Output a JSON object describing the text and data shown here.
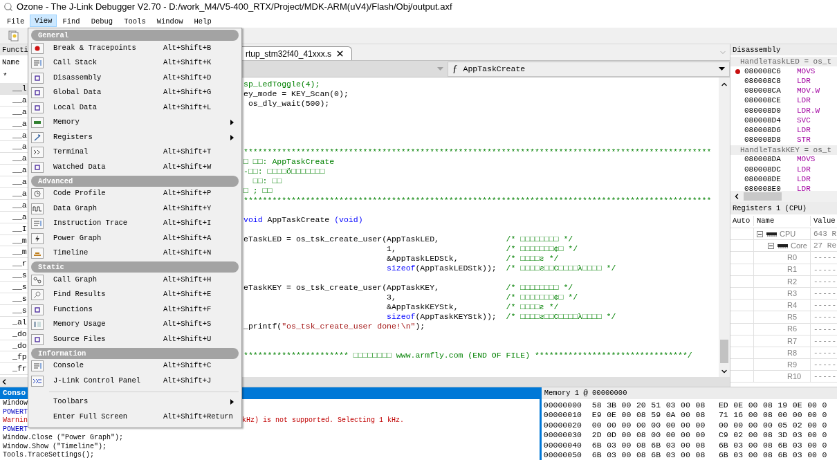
{
  "window": {
    "title": "Ozone - The J-Link Debugger V2.70 - D:/work_M4/V5-400_RTX/Project/MDK-ARM(uV4)/Flash/Obj/output.axf"
  },
  "menu_bar": [
    {
      "label": "File",
      "selected": false
    },
    {
      "label": "View",
      "selected": true
    },
    {
      "label": "Find",
      "selected": false
    },
    {
      "label": "Debug",
      "selected": false
    },
    {
      "label": "Tools",
      "selected": false
    },
    {
      "label": "Window",
      "selected": false
    },
    {
      "label": "Help",
      "selected": false
    }
  ],
  "functions_panel": {
    "title": "Functi",
    "column": "Name",
    "filter": "*",
    "rows": [
      {
        "name": "__l",
        "selected": true
      },
      {
        "name": "__a",
        "selected": false
      },
      {
        "name": "__a",
        "selected": false
      },
      {
        "name": "__a",
        "selected": false
      },
      {
        "name": "__a",
        "selected": false
      },
      {
        "name": "__a",
        "selected": false
      },
      {
        "name": "__a",
        "selected": false
      },
      {
        "name": "__a",
        "selected": false
      },
      {
        "name": "__a",
        "selected": false
      },
      {
        "name": "__a",
        "selected": false
      },
      {
        "name": "__a",
        "selected": false
      },
      {
        "name": "__a",
        "selected": false
      },
      {
        "name": "__I",
        "selected": false
      },
      {
        "name": "__m",
        "selected": false
      },
      {
        "name": "__m",
        "selected": false
      },
      {
        "name": "__r",
        "selected": false
      },
      {
        "name": "__s",
        "selected": false
      },
      {
        "name": "__s",
        "selected": false
      },
      {
        "name": "__s",
        "selected": false
      },
      {
        "name": "__s",
        "selected": false
      },
      {
        "name": "_al",
        "selected": false
      },
      {
        "name": "_do",
        "selected": false
      },
      {
        "name": "_do",
        "selected": false
      },
      {
        "name": "_fp",
        "selected": false
      },
      {
        "name": "_fr",
        "selected": false
      }
    ]
  },
  "editor": {
    "tab": "rtup_stm32f40_41xxx.s",
    "function_symbol": "ƒ",
    "function": "AppTaskCreate",
    "lines": [
      {
        "segments": [
          {
            "kind": "comment",
            "text": "sp_LedToggle(4);"
          }
        ]
      },
      {
        "segments": [
          {
            "kind": "plain",
            "text": "ey_mode = KEY_Scan(0);"
          }
        ]
      },
      {
        "segments": [
          {
            "kind": "plain",
            "text": " os_dly_wait(500);"
          }
        ]
      },
      {
        "blank": true
      },
      {
        "blank": true
      },
      {
        "blank": true
      },
      {
        "blank": true
      },
      {
        "segments": [
          {
            "kind": "comment",
            "text": "**************************************************************************************************"
          }
        ]
      },
      {
        "segments": [
          {
            "kind": "comment",
            "text": "□ □□: AppTaskCreate"
          }
        ]
      },
      {
        "segments": [
          {
            "kind": "comment",
            "text": "-□□: □□□□ö□□□□□□□"
          }
        ]
      },
      {
        "segments": [
          {
            "kind": "comment",
            "text": "  □□: □□"
          }
        ]
      },
      {
        "segments": [
          {
            "kind": "comment",
            "text": "□ ; □□"
          }
        ]
      },
      {
        "segments": [
          {
            "kind": "comment",
            "text": "**************************************************************************************************"
          }
        ]
      },
      {
        "blank": true
      },
      {
        "segments": [
          {
            "kind": "keyword",
            "text": "void"
          },
          {
            "kind": "plain",
            "text": " AppTaskCreate "
          },
          {
            "kind": "keyword",
            "text": "(void)"
          }
        ]
      },
      {
        "blank": true
      },
      {
        "segments": [
          {
            "kind": "plain",
            "text": "eTaskLED = os_tsk_create_user(AppTaskLED,              "
          },
          {
            "kind": "comment",
            "text": "/* □□□□□□□□ */"
          }
        ]
      },
      {
        "segments": [
          {
            "kind": "plain",
            "text": "                              1,                       "
          },
          {
            "kind": "comment",
            "text": "/* □□□□□□□¢□ */"
          }
        ]
      },
      {
        "segments": [
          {
            "kind": "plain",
            "text": "                              &AppTaskLEDStk,          "
          },
          {
            "kind": "comment",
            "text": "/* □□□□ƨ */"
          }
        ]
      },
      {
        "segments": [
          {
            "kind": "keyword",
            "text": "                              sizeof"
          },
          {
            "kind": "plain",
            "text": "(AppTaskLEDStk));  "
          },
          {
            "kind": "comment",
            "text": "/* □□□□ƨ□□C□□□□λ□□□□ */"
          }
        ]
      },
      {
        "blank": true
      },
      {
        "segments": [
          {
            "kind": "plain",
            "text": "eTaskKEY = os_tsk_create_user(AppTaskKEY,              "
          },
          {
            "kind": "comment",
            "text": "/* □□□□□□□□ */"
          }
        ]
      },
      {
        "segments": [
          {
            "kind": "plain",
            "text": "                              3,                       "
          },
          {
            "kind": "comment",
            "text": "/* □□□□□□□¢□ */"
          }
        ]
      },
      {
        "segments": [
          {
            "kind": "plain",
            "text": "                              &AppTaskKEYStk,          "
          },
          {
            "kind": "comment",
            "text": "/* □□□□ƨ */"
          }
        ]
      },
      {
        "segments": [
          {
            "kind": "keyword",
            "text": "                              sizeof"
          },
          {
            "kind": "plain",
            "text": "(AppTaskKEYStk));  "
          },
          {
            "kind": "comment",
            "text": "/* □□□□ƨ□□C□□□□λ□□□□ */"
          }
        ]
      },
      {
        "segments": [
          {
            "kind": "plain",
            "text": "_printf("
          },
          {
            "kind": "string",
            "text": "\"os_tsk_create_user done!\\n\""
          },
          {
            "kind": "plain",
            "text": ");"
          }
        ]
      },
      {
        "blank": true
      },
      {
        "blank": true
      },
      {
        "segments": [
          {
            "kind": "comment",
            "text": "********************** □□□□□□□□ www.armfly.com (END OF FILE) ********************************/"
          }
        ]
      }
    ]
  },
  "view_menu": {
    "sections": [
      {
        "header": "General",
        "items": [
          {
            "label": "Break & Tracepoints",
            "shortcut": "Alt+Shift+B",
            "submenu": false
          },
          {
            "label": "Call Stack",
            "shortcut": "Alt+Shift+K",
            "submenu": false
          },
          {
            "label": "Disassembly",
            "shortcut": "Alt+Shift+D",
            "submenu": false
          },
          {
            "label": "Global Data",
            "shortcut": "Alt+Shift+G",
            "submenu": false
          },
          {
            "label": "Local Data",
            "shortcut": "Alt+Shift+L",
            "submenu": false
          },
          {
            "label": "Memory",
            "submenu": true
          },
          {
            "label": "Registers",
            "submenu": true
          },
          {
            "label": "Terminal",
            "shortcut": "Alt+Shift+T",
            "submenu": false
          },
          {
            "label": "Watched Data",
            "shortcut": "Alt+Shift+W",
            "submenu": false
          }
        ]
      },
      {
        "header": "Advanced",
        "items": [
          {
            "label": "Code Profile",
            "shortcut": "Alt+Shift+P",
            "submenu": false
          },
          {
            "label": "Data Graph",
            "shortcut": "Alt+Shift+Y",
            "submenu": false
          },
          {
            "label": "Instruction Trace",
            "shortcut": "Alt+Shift+I",
            "submenu": false
          },
          {
            "label": "Power Graph",
            "shortcut": "Alt+Shift+A",
            "submenu": false
          },
          {
            "label": "Timeline",
            "shortcut": "Alt+Shift+N",
            "submenu": false
          }
        ]
      },
      {
        "header": "Static",
        "items": [
          {
            "label": "Call Graph",
            "shortcut": "Alt+Shift+H",
            "submenu": false
          },
          {
            "label": "Find Results",
            "shortcut": "Alt+Shift+E",
            "submenu": false
          },
          {
            "label": "Functions",
            "shortcut": "Alt+Shift+F",
            "submenu": false
          },
          {
            "label": "Memory Usage",
            "shortcut": "Alt+Shift+S",
            "submenu": false
          },
          {
            "label": "Source Files",
            "shortcut": "Alt+Shift+U",
            "submenu": false
          }
        ]
      },
      {
        "header": "Information",
        "items": [
          {
            "label": "Console",
            "shortcut": "Alt+Shift+C",
            "submenu": false
          },
          {
            "label": "J-Link Control Panel",
            "shortcut": "Alt+Shift+J",
            "submenu": false
          }
        ]
      },
      {
        "items": [
          {
            "label": "Toolbars",
            "submenu": true
          },
          {
            "label": "Enter Full Screen",
            "shortcut": "Alt+Shift+Return",
            "submenu": false
          }
        ]
      }
    ]
  },
  "disassembly": {
    "title": "Disassembly",
    "groups": [
      {
        "source": "HandleTaskLED = os_t",
        "rows": [
          {
            "address": "080008C6",
            "mnemonic": "MOVS",
            "breakpoint": true
          },
          {
            "address": "080008C8",
            "mnemonic": "LDR",
            "breakpoint": false
          },
          {
            "address": "080008CA",
            "mnemonic": "MOV.W",
            "breakpoint": false
          },
          {
            "address": "080008CE",
            "mnemonic": "LDR",
            "breakpoint": false
          },
          {
            "address": "080008D0",
            "mnemonic": "LDR.W",
            "breakpoint": false
          },
          {
            "address": "080008D4",
            "mnemonic": "SVC",
            "breakpoint": false
          },
          {
            "address": "080008D6",
            "mnemonic": "LDR",
            "breakpoint": false
          },
          {
            "address": "080008D8",
            "mnemonic": "STR",
            "breakpoint": false
          }
        ]
      },
      {
        "source": "HandleTaskKEY = os_t",
        "rows": [
          {
            "address": "080008DA",
            "mnemonic": "MOVS",
            "breakpoint": false
          },
          {
            "address": "080008DC",
            "mnemonic": "LDR",
            "breakpoint": false
          },
          {
            "address": "080008DE",
            "mnemonic": "LDR",
            "breakpoint": false
          },
          {
            "address": "080008E0",
            "mnemonic": "LDR",
            "breakpoint": false
          }
        ]
      }
    ]
  },
  "registers": {
    "title": "Registers 1 (CPU)",
    "columns": [
      "Auto",
      "Name",
      "Value"
    ],
    "tree": [
      {
        "name": "CPU",
        "value": "643 R",
        "expanded": true,
        "children": [
          {
            "name": "Core",
            "value": "27 Re",
            "expanded": true,
            "children": [
              {
                "name": "R0",
                "value": "-----"
              },
              {
                "name": "R1",
                "value": "-----"
              },
              {
                "name": "R2",
                "value": "-----"
              },
              {
                "name": "R3",
                "value": "-----"
              },
              {
                "name": "R4",
                "value": "-----"
              },
              {
                "name": "R5",
                "value": "-----"
              },
              {
                "name": "R6",
                "value": "-----"
              },
              {
                "name": "R7",
                "value": "-----"
              },
              {
                "name": "R8",
                "value": "-----"
              },
              {
                "name": "R9",
                "value": "-----"
              },
              {
                "name": "R10",
                "value": "-----"
              }
            ]
          }
        ]
      }
    ]
  },
  "console": {
    "title": "Conso",
    "lines": [
      {
        "kind": "command",
        "text": "Window"
      },
      {
        "kind": "info",
        "text": "POWERT"
      },
      {
        "kind": "warning",
        "text": "Warnin",
        "text_right": "kHz) is not supported. Selecting 1 kHz."
      },
      {
        "kind": "info",
        "text": "POWERT"
      },
      {
        "kind": "command",
        "text": "Window.Close (\"Power Graph\");"
      },
      {
        "kind": "command",
        "text": "Window.Show (\"Timeline\");"
      },
      {
        "kind": "command",
        "text": "Tools.TraceSettings();"
      }
    ]
  },
  "memory": {
    "title": "Memory 1 @ 00000000",
    "rows": [
      {
        "address": "00000000",
        "bytes": [
          "58",
          "3B",
          "00",
          "20",
          "51",
          "03",
          "00",
          "08",
          "ED",
          "0E",
          "00",
          "08",
          "19",
          "0E",
          "00",
          "0"
        ]
      },
      {
        "address": "00000010",
        "bytes": [
          "E9",
          "0E",
          "00",
          "08",
          "59",
          "0A",
          "00",
          "08",
          "71",
          "16",
          "00",
          "08",
          "00",
          "00",
          "00",
          "0"
        ]
      },
      {
        "address": "00000020",
        "bytes": [
          "00",
          "00",
          "00",
          "00",
          "00",
          "00",
          "00",
          "00",
          "00",
          "00",
          "00",
          "00",
          "05",
          "02",
          "00",
          "0"
        ]
      },
      {
        "address": "00000030",
        "bytes": [
          "2D",
          "0D",
          "00",
          "08",
          "00",
          "00",
          "00",
          "00",
          "C9",
          "02",
          "00",
          "08",
          "3D",
          "03",
          "00",
          "0"
        ]
      },
      {
        "address": "00000040",
        "bytes": [
          "6B",
          "03",
          "00",
          "08",
          "6B",
          "03",
          "00",
          "08",
          "6B",
          "03",
          "00",
          "08",
          "6B",
          "03",
          "00",
          "0"
        ]
      },
      {
        "address": "00000050",
        "bytes": [
          "6B",
          "03",
          "00",
          "08",
          "6B",
          "03",
          "00",
          "08",
          "6B",
          "03",
          "00",
          "08",
          "6B",
          "03",
          "00",
          "0"
        ]
      }
    ]
  }
}
